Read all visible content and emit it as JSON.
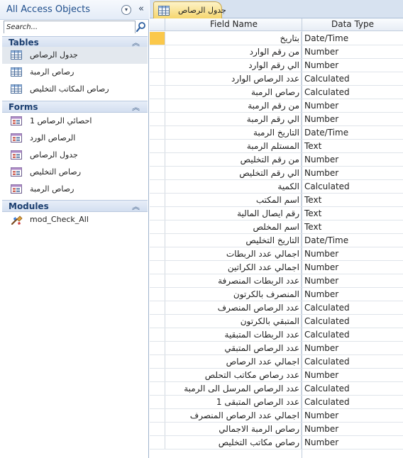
{
  "nav": {
    "title": "All Access Objects",
    "menu_glyph": "▾",
    "collapse_glyph": "«",
    "search_placeholder": "Search...",
    "groups": [
      {
        "name": "Tables",
        "items": [
          {
            "label": "جدول الرصاص",
            "icon": "table-icon",
            "selected": true
          },
          {
            "label": "رصاص الرمبة",
            "icon": "table-icon"
          },
          {
            "label": "رصاص المكاتب التخليص",
            "icon": "table-icon"
          }
        ]
      },
      {
        "name": "Forms",
        "items": [
          {
            "label": "احصائي الرصاص 1",
            "icon": "form-icon"
          },
          {
            "label": "الرصاص الورد",
            "icon": "form-icon"
          },
          {
            "label": "جدول الرصاص",
            "icon": "form-icon"
          },
          {
            "label": "رصاص التخليص",
            "icon": "form-icon"
          },
          {
            "label": "رصاص الرمبة",
            "icon": "form-icon"
          }
        ]
      },
      {
        "name": "Modules",
        "items": [
          {
            "label": "mod_Check_All",
            "icon": "module-icon"
          }
        ]
      }
    ]
  },
  "document": {
    "tab_title": "جدول الرصاص",
    "columns": {
      "field_name": "Field Name",
      "data_type": "Data Type"
    },
    "current_row_index": 0,
    "fields": [
      {
        "name": "بتاريخ",
        "type": "Date/Time"
      },
      {
        "name": "من رقم الوارد",
        "type": "Number"
      },
      {
        "name": "الي رقم الوارد",
        "type": "Number"
      },
      {
        "name": "عدد الرصاص الوارد",
        "type": "Calculated"
      },
      {
        "name": "رصاص الرمبة",
        "type": "Calculated"
      },
      {
        "name": "من رقم الرمبة",
        "type": "Number"
      },
      {
        "name": "الي رقم الرمبة",
        "type": "Number"
      },
      {
        "name": "التاريخ الرمبة",
        "type": "Date/Time"
      },
      {
        "name": "المستلم الرمبة",
        "type": "Text"
      },
      {
        "name": "من رقم التخليص",
        "type": "Number"
      },
      {
        "name": "الي رقم التخليص",
        "type": "Number"
      },
      {
        "name": "الكمية",
        "type": "Calculated"
      },
      {
        "name": "اسم المكتب",
        "type": "Text"
      },
      {
        "name": "رقم ايصال المالية",
        "type": "Text"
      },
      {
        "name": "اسم المخلص",
        "type": "Text"
      },
      {
        "name": "التاريخ التخليص",
        "type": "Date/Time"
      },
      {
        "name": "اجمالي عدد الربطات",
        "type": "Number"
      },
      {
        "name": "اجمالي عدد الكراتين",
        "type": "Number"
      },
      {
        "name": "عدد الربطات المنصرفة",
        "type": "Number"
      },
      {
        "name": "المنصرف بالكرتون",
        "type": "Number"
      },
      {
        "name": "عدد الرصاص المنصرف",
        "type": "Calculated"
      },
      {
        "name": "المتبقي بالكرتون",
        "type": "Calculated"
      },
      {
        "name": "عدد  الربطات المتبقية",
        "type": "Calculated"
      },
      {
        "name": "عدد الرصاص المتبقي",
        "type": "Number"
      },
      {
        "name": "اجمالي عدد الرصاص",
        "type": "Calculated"
      },
      {
        "name": "عدد رصاص  مكاتب التحلص",
        "type": "Number"
      },
      {
        "name": "عدد الرصاص المرسل الى الرمبة",
        "type": "Calculated"
      },
      {
        "name": "عدد الرصاص المتبقى 1",
        "type": "Calculated"
      },
      {
        "name": "اجمالي عدد الرصاص المنصرف",
        "type": "Number"
      },
      {
        "name": "رصاص الرمبة الاجمالي",
        "type": "Number"
      },
      {
        "name": "رصاص مكاتب التخليص",
        "type": "Number"
      }
    ]
  }
}
